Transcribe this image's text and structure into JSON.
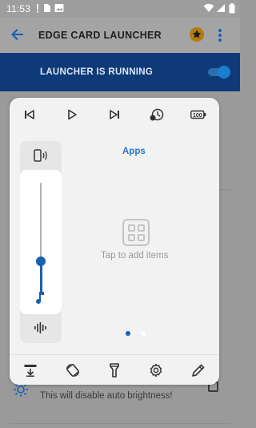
{
  "status_bar": {
    "time": "11:53"
  },
  "app_bar": {
    "title": "EDGE CARD LAUNCHER"
  },
  "run_bar": {
    "label": "LAUNCHER IS RUNNING",
    "toggle_on": true
  },
  "background": {
    "brightness_hint": "This will disable auto brightness!"
  },
  "panel": {
    "media_controls": [
      "skip-previous-icon",
      "play-icon",
      "skip-next-icon",
      "timer-icon",
      "battery-100-icon"
    ],
    "volume": {
      "level": 0.3
    },
    "apps": {
      "title": "Apps",
      "empty_text": "Tap to add items",
      "page_count": 2,
      "current_page": 1
    },
    "bottom_actions": [
      "download-icon",
      "screen-rotation-icon",
      "flashlight-icon",
      "settings-icon",
      "edit-icon"
    ]
  },
  "colors": {
    "accent": "#1a5fb4",
    "run_bar": "#0e3a78",
    "apps_title": "#2a76c8"
  }
}
